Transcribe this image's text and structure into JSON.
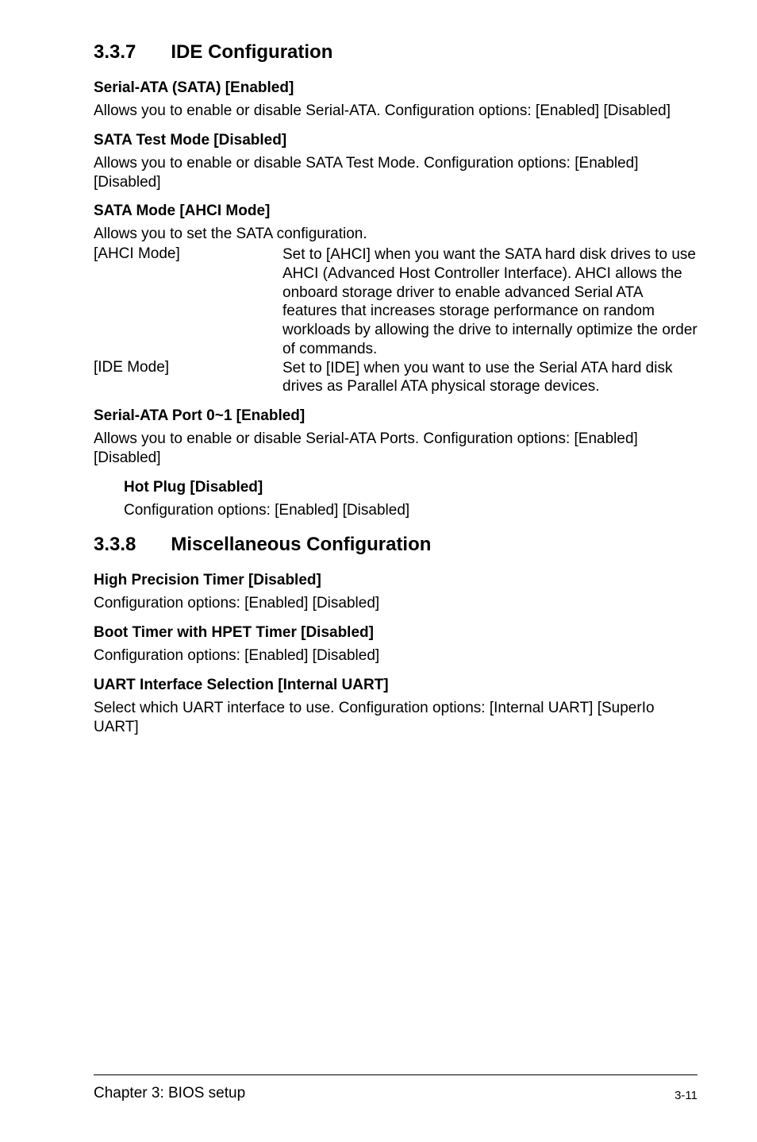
{
  "section337": {
    "num": "3.3.7",
    "title": "IDE Configuration",
    "items": {
      "serial_ata": {
        "h": "Serial-ATA (SATA) [Enabled]",
        "p": "Allows you to enable or disable Serial-ATA. Configuration options: [Enabled] [Disabled]"
      },
      "sata_test": {
        "h": "SATA Test Mode [Disabled]",
        "p": "Allows you to enable or disable SATA Test Mode. Configuration options: [Enabled] [Disabled]"
      },
      "sata_mode": {
        "h": "SATA Mode [AHCI Mode]",
        "intro": "Allows you to set the SATA configuration.",
        "rows": {
          "ahci": {
            "term": "[AHCI Mode]",
            "desc": "Set to [AHCI] when you want the SATA hard disk drives to use AHCI (Advanced Host Controller Interface). AHCI allows the onboard storage driver to enable advanced Serial ATA features that increases storage performance on random workloads by allowing the drive to internally optimize the order of commands."
          },
          "ide": {
            "term": "[IDE Mode]",
            "desc": "Set to [IDE] when you want to use the Serial ATA hard disk drives as Parallel ATA physical storage devices."
          }
        }
      },
      "port01": {
        "h": "Serial-ATA Port 0~1 [Enabled]",
        "p": "Allows you to enable or disable Serial-ATA Ports. Configuration options: [Enabled] [Disabled]",
        "hotplug": {
          "h": "Hot Plug [Disabled]",
          "p": "Configuration options: [Enabled] [Disabled]"
        }
      }
    }
  },
  "section338": {
    "num": "3.3.8",
    "title": "Miscellaneous Configuration",
    "items": {
      "hpt": {
        "h": "High Precision Timer [Disabled]",
        "p": "Configuration options: [Enabled] [Disabled]"
      },
      "boot_hpet": {
        "h": "Boot Timer with HPET Timer [Disabled]",
        "p": "Configuration options: [Enabled] [Disabled]"
      },
      "uart": {
        "h": "UART Interface Selection [Internal UART]",
        "p": "Select which UART interface to use. Configuration options: [Internal UART] [SuperIo UART]"
      }
    }
  },
  "footer": {
    "left": "Chapter 3: BIOS setup",
    "right": "3-11"
  }
}
